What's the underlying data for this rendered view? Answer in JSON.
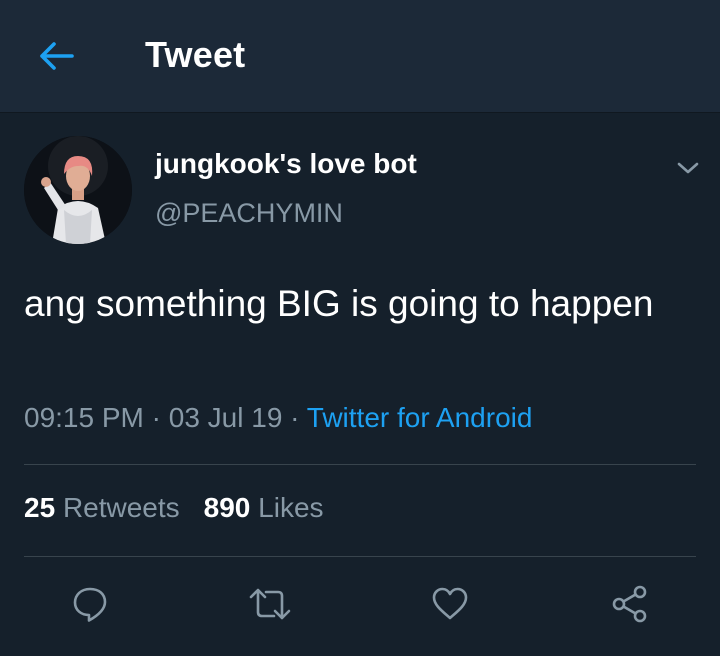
{
  "header": {
    "title": "Tweet",
    "back_icon": "arrow-left-icon"
  },
  "tweet": {
    "display_name": "jungkook's love bot",
    "handle": "@PEACHYMIN",
    "text": "ang something BIG is going to happen",
    "time": "09:15 PM",
    "date": "03 Jul 19",
    "separator": "·",
    "source": "Twitter for Android",
    "retweets_count": "25",
    "retweets_label": "Retweets",
    "likes_count": "890",
    "likes_label": "Likes"
  },
  "actions": [
    {
      "icon": "reply-icon"
    },
    {
      "icon": "retweet-icon"
    },
    {
      "icon": "heart-icon"
    },
    {
      "icon": "share-icon"
    }
  ],
  "colors": {
    "background": "#15202b",
    "header": "#1c2938",
    "accent": "#1da1f2",
    "secondary_text": "#8899a6",
    "divider": "#38444d"
  }
}
